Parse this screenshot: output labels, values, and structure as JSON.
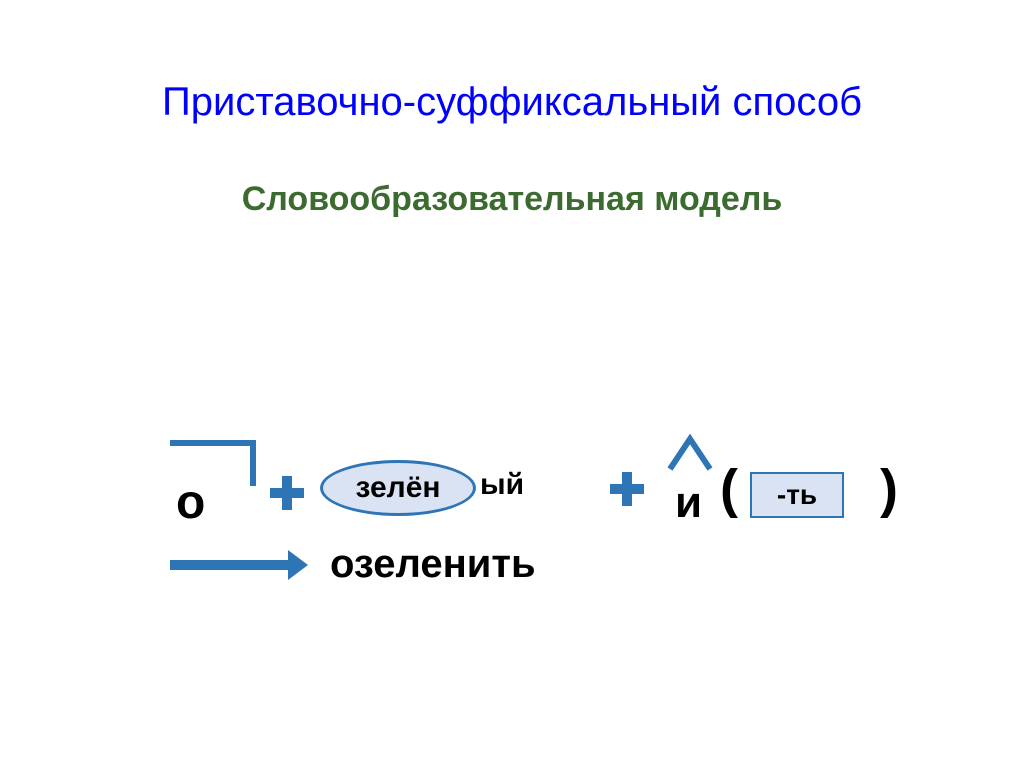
{
  "title": "Приставочно-суффиксальный способ",
  "subtitle": "Словообразовательная модель",
  "prefix": "о",
  "root": "зелён",
  "adj_ending": "ый",
  "suffix": "и",
  "infinitive_ending": "-ть",
  "paren_left": "(",
  "paren_right": ")",
  "result": "озеленить"
}
